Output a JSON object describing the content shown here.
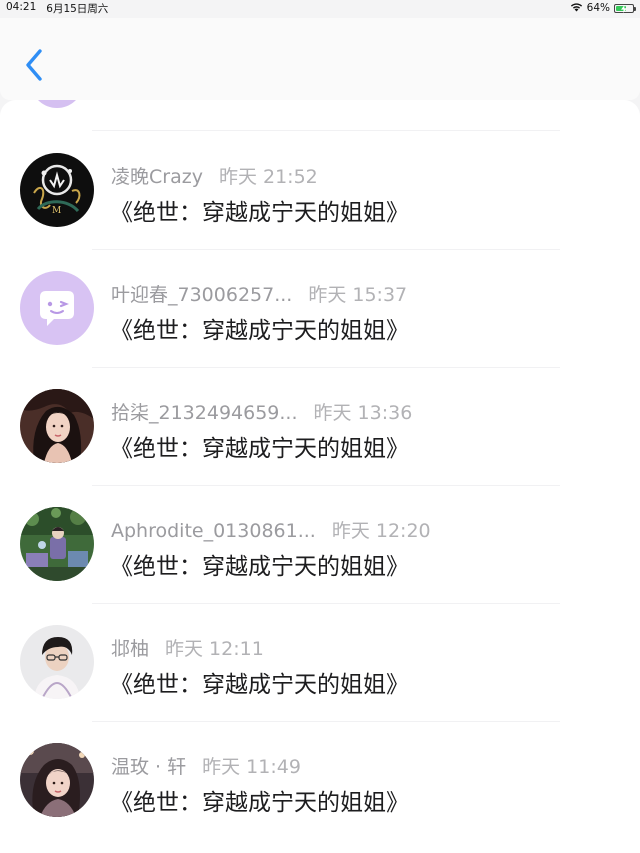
{
  "status_bar": {
    "time": "04:21",
    "date": "6月15日周六",
    "battery": "64%",
    "battery_level": 0.64,
    "wifi_icon": "wifi-icon",
    "charging_icon": "bolt-icon"
  },
  "nav": {
    "back_icon": "chevron-left-icon",
    "accent_color": "#2f8ef5"
  },
  "comments": [
    {
      "user": "凌晚Crazy",
      "time": "昨天 21:52",
      "text": "《绝世：穿越成宁天的姐姐》",
      "avatar": "avatar-lily-logo"
    },
    {
      "user": "叶迎春_73006257...",
      "time": "昨天 15:37",
      "text": "《绝世：穿越成宁天的姐姐》",
      "avatar": "avatar-default-chat"
    },
    {
      "user": "拾柒_2132494659...",
      "time": "昨天 13:36",
      "text": "《绝世：穿越成宁天的姐姐》",
      "avatar": "avatar-photo-woman"
    },
    {
      "user": "Aphrodite_0130861...",
      "time": "昨天 12:20",
      "text": "《绝世：穿越成宁天的姐姐》",
      "avatar": "avatar-photo-garden"
    },
    {
      "user": "邶柚",
      "time": "昨天 12:11",
      "text": "《绝世：穿越成宁天的姐姐》",
      "avatar": "avatar-photo-man"
    },
    {
      "user": "温玫 · 轩",
      "time": "昨天 11:49",
      "text": "《绝世：穿越成宁天的姐姐》",
      "avatar": "avatar-photo-woman-2"
    }
  ]
}
